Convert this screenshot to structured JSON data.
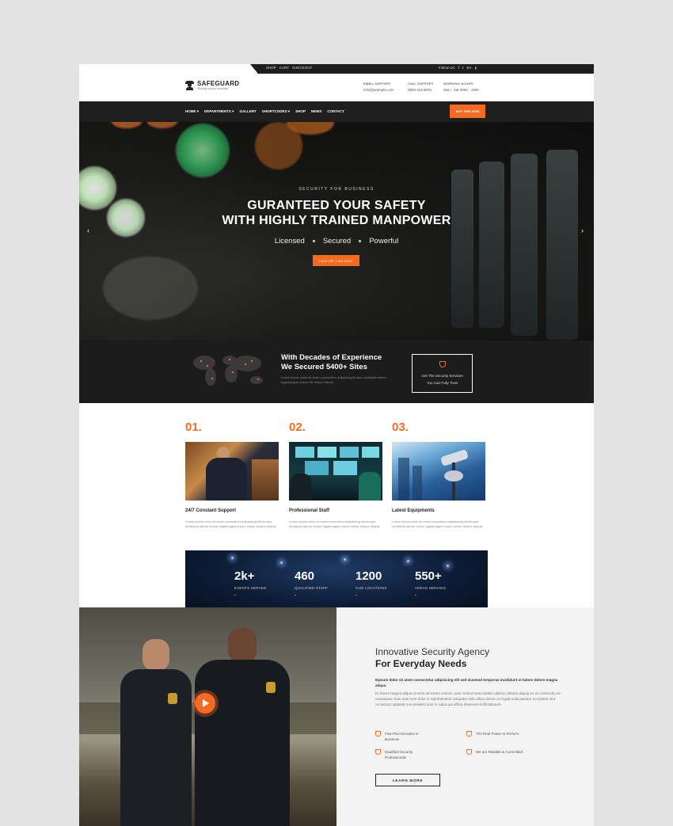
{
  "topbar": {
    "links": [
      "SHOP",
      "CART",
      "CHECKOUT"
    ],
    "follow_label": "Follow Us:",
    "social_icons": [
      "facebook-icon",
      "twitter-icon",
      "googleplus-icon",
      "pinterest-icon"
    ],
    "social_glyphs": [
      "f",
      "t",
      "G+",
      "p"
    ]
  },
  "header": {
    "logo_name": "SAFEGUARD",
    "logo_tagline": "Security at your doorstep",
    "email_label": "EMAIL SUPPORT",
    "email_value": "info@example.com",
    "call_label": "CALL SUPPORT",
    "call_value": "0800 123 9876",
    "hours_label": "WORKING HOURS",
    "hours_value": "Mon - Sat 0900 - 1900"
  },
  "nav": {
    "items": [
      "HOME ▾",
      "DEPARTMENTS ▾",
      "GALLERY",
      "SHORTCODES ▾",
      "SHOP",
      "NEWS",
      "CONTACT"
    ],
    "buy_label": "BUY THIS NOW"
  },
  "hero": {
    "kicker": "SECURITY FOR BUSINESS",
    "title_line1": "GURANTEED YOUR SAFETY",
    "title_line2": "WITH HIGHLY TRAINED MANPOWER",
    "tags": [
      "Licensed",
      "Secured",
      "Powerful"
    ],
    "button": "HOW WE CAN HELP",
    "prev": "‹",
    "next": "›"
  },
  "experience": {
    "title_line1": "With Decades of Experience",
    "title_line2": "We Secured 5400+ Sites",
    "text": "Lorem ipsum dolor sit amet consectetur adipiscing tempor incididunt labore fugiatmagna dolore elit tempor labore",
    "box_line1": "Get The Security Services",
    "box_line2": "You Can Fully Trust"
  },
  "features": [
    {
      "num": "01.",
      "title": "24/7 Constant Support",
      "desc": "Lorem ipsum dolor sit amet consectetur adipisicing elit tempor incididunt labore dolore fugiatmagna exerci dolore tempor aliquip"
    },
    {
      "num": "02.",
      "title": "Professional Staff",
      "desc": "Lorem ipsum dolor sit amet consectetur adipisicing elit tempor incididunt labore dolore fugiatmagna exerci dolore tempor aliquip"
    },
    {
      "num": "03.",
      "title": "Latest Equipments",
      "desc": "Lorem ipsum dolor sit amet consectetur adipisicing elit tempor incididunt labore dolore fugiatmagna exerci dolore tempor aliquip"
    }
  ],
  "stats": [
    {
      "value": "2k+",
      "label": "EVENTS SERVED"
    },
    {
      "value": "460",
      "label": "QUALIFIED STAFF"
    },
    {
      "value": "1200",
      "label": "OUR LOCATIONS"
    },
    {
      "value": "550+",
      "label": "AREAS SERVING"
    }
  ],
  "about": {
    "title_line1": "Innovative Security Agency",
    "title_line2": "For Everyday Needs",
    "lead": "Eipsum dolor sit amet consectetur adipisicing elit sed eiusmod temporas incididunt ut labore dolore magna aliqua.",
    "body": "Et dolore magna aliqua ut enim ad minim veniam, quis nostrud exercitation ullamco laboris aliquip ex ea commodo ea consequat. Duis aute irure dolor in reprehenderit voluptate velit cillum dolore eu fugiat nulla pariatur excepteur sint occaecat cupidatat non proident sunt in culpa qui officia deserunt mollit laborum.",
    "bullets": [
      "Five-Plus Decades in Business",
      "The Real Power to Perform",
      "Qualified Security Professionals",
      "We are Reliable & Committed"
    ],
    "button": "LEARN MORE"
  },
  "colors": {
    "accent": "#f26b21",
    "dark": "#1e1e1e"
  }
}
